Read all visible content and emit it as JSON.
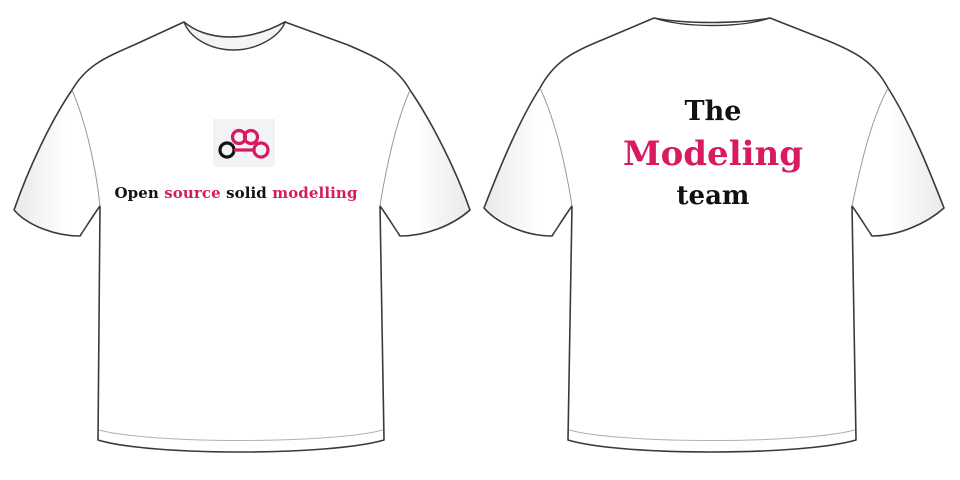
{
  "front": {
    "slogan_word1": "Open",
    "slogan_word2": "source",
    "slogan_word3": "solid",
    "slogan_word4": "modelling"
  },
  "back": {
    "line1": "The",
    "line2": "Modeling",
    "line3": "team"
  },
  "colors": {
    "accent": "#d81b60",
    "text": "#111111",
    "shirt": "#ffffff",
    "outline": "#3a3a3a"
  },
  "icons": {
    "logo": "linked-rings-logo-icon"
  }
}
